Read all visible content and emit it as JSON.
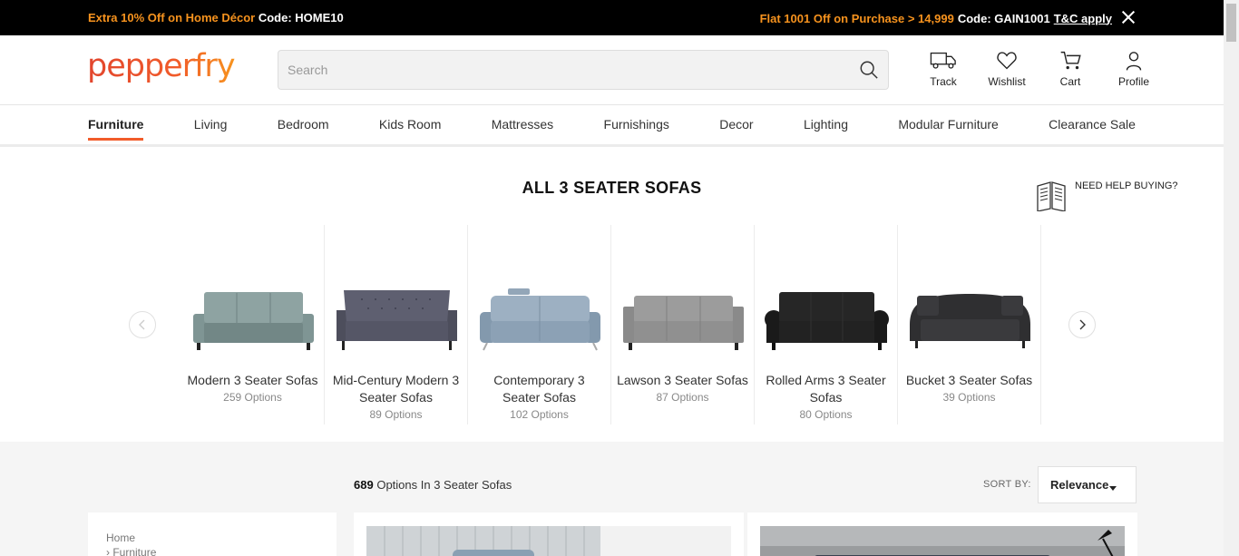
{
  "promo": {
    "left_offer": "Extra 10% Off on Home Décor",
    "left_code_label": "Code: HOME10",
    "right_offer": "Flat 1001 Off on Purchase > 14,999",
    "right_code_label": "Code: GAIN1001",
    "tc_label": "T&C apply",
    "close_icon": "close-icon"
  },
  "header": {
    "logo_text": "pepperfry",
    "search_placeholder": "Search",
    "search_icon": "search-icon",
    "icons": [
      {
        "label": "Track",
        "icon": "truck-icon"
      },
      {
        "label": "Wishlist",
        "icon": "heart-icon"
      },
      {
        "label": "Cart",
        "icon": "cart-icon"
      },
      {
        "label": "Profile",
        "icon": "user-icon"
      }
    ]
  },
  "nav": {
    "items": [
      "Furniture",
      "Living",
      "Bedroom",
      "Kids Room",
      "Mattresses",
      "Furnishings",
      "Decor",
      "Lighting",
      "Modular Furniture",
      "Clearance Sale"
    ],
    "active": "Furniture"
  },
  "page": {
    "title": "ALL 3 SEATER SOFAS",
    "help_label": "NEED HELP BUYING?",
    "help_icon": "book-icon"
  },
  "categories": [
    {
      "name": "Modern 3 Seater Sofas",
      "count": "259 Options",
      "color": "#7f9594"
    },
    {
      "name": "Mid-Century Modern 3 Seater Sofas",
      "count": "89 Options",
      "color": "#5a5b6a"
    },
    {
      "name": "Contemporary 3 Seater Sofas",
      "count": "102 Options",
      "color": "#8fa2b3"
    },
    {
      "name": "Lawson 3 Seater Sofas",
      "count": "87 Options",
      "color": "#8c8c8c"
    },
    {
      "name": "Rolled Arms 3 Seater Sofas",
      "count": "80 Options",
      "color": "#1f1f1f"
    },
    {
      "name": "Bucket 3 Seater Sofas",
      "count": "39 Options",
      "color": "#2f2f31"
    }
  ],
  "listing": {
    "count": "689",
    "count_suffix": "Options In 3 Seater Sofas",
    "sort_label": "SORT BY:",
    "sort_value": "Relevance",
    "breadcrumb": [
      "Home",
      "Furniture"
    ]
  },
  "colors": {
    "accent": "#f15b2a",
    "promo_orange": "#f7931e"
  }
}
